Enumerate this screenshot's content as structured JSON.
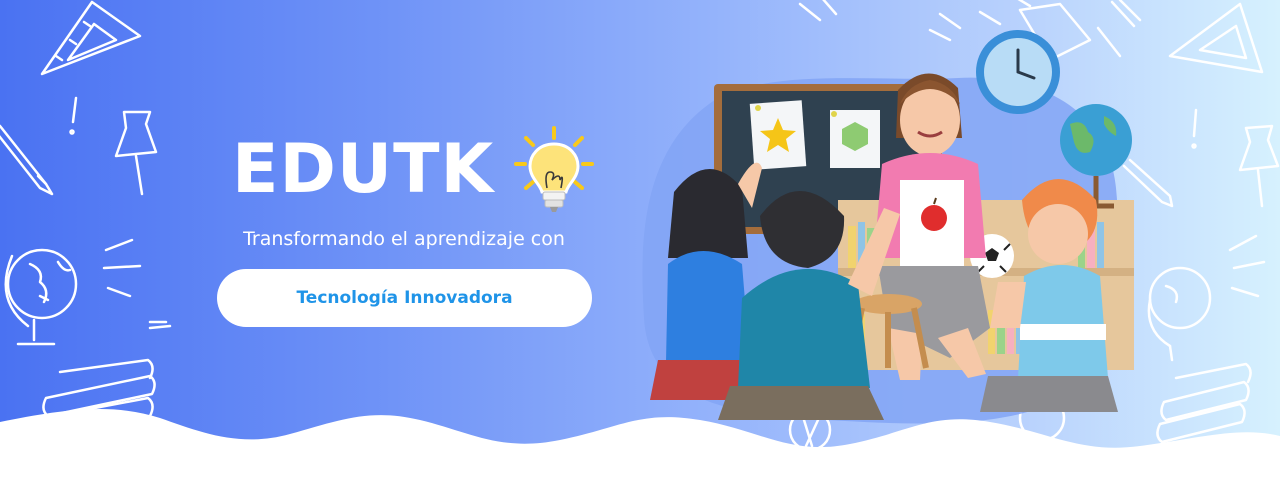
{
  "brand": {
    "name": "EDUTK"
  },
  "hero": {
    "tagline": "Transformando el aprendizaje con",
    "cta_label": "Tecnología Innovadora"
  },
  "colors": {
    "gradient_start": "#4a72f2",
    "gradient_end": "#d6f1fe",
    "cta_text": "#1f94e8",
    "bulb": "#f8c91a"
  },
  "icons": [
    "lightbulb-icon",
    "clock-icon",
    "globe-icon",
    "star-icon",
    "apple-icon",
    "soccer-ball-icon",
    "push-pin-icon",
    "book-stack-icon",
    "triangle-ruler-icon",
    "pencil-icon"
  ]
}
